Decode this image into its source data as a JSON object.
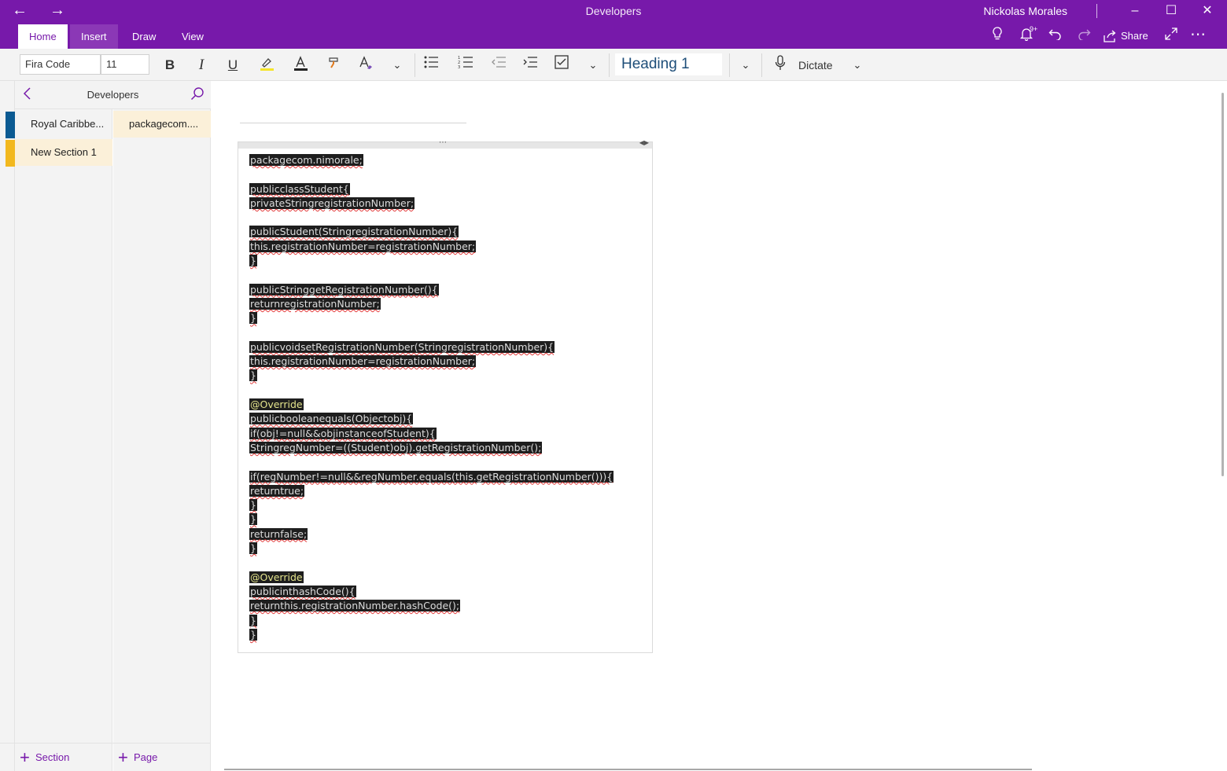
{
  "window": {
    "title": "Developers",
    "user": "Nickolas Morales"
  },
  "ribbon": {
    "tabs": [
      {
        "label": "Home",
        "active": true
      },
      {
        "label": "Insert",
        "active": false
      },
      {
        "label": "Draw",
        "active": false
      },
      {
        "label": "View",
        "active": false
      }
    ],
    "share_label": "Share",
    "notification_badge": "9+"
  },
  "toolbar": {
    "font_name": "Fira Code",
    "font_size": "11",
    "style": "Heading 1",
    "dictate_label": "Dictate",
    "highlight_color": "#f5e52a",
    "font_color": "#c00000"
  },
  "navigation": {
    "notebook_title": "Developers",
    "sections": [
      {
        "label": "Royal Caribbe...",
        "color": "#0b5a92",
        "selected": false
      },
      {
        "label": "New Section 1",
        "color": "#f2b81e",
        "selected": true
      }
    ],
    "pages": [
      {
        "label": "packagecom...."
      }
    ],
    "add_section_label": "Section",
    "add_page_label": "Page"
  },
  "code_lines": [
    "packagecom.nimorale;",
    "",
    "publicclassStudent{",
    "privateStringregistrationNumber;",
    "",
    "publicStudent(StringregistrationNumber){",
    "this.registrationNumber=registrationNumber;",
    "}",
    "",
    "publicStringgetRegistrationNumber(){",
    "returnregistrationNumber;",
    "}",
    "",
    "publicvoidsetRegistrationNumber(StringregistrationNumber){",
    "this.registrationNumber=registrationNumber;",
    "}",
    "",
    "@Override",
    "publicbooleanequals(Objectobj){",
    "if(obj!=null&&objinstanceofStudent){",
    "StringregNumber=((Student)obj).getRegistrationNumber();",
    "",
    "if(regNumber!=null&&regNumber.equals(this.getRegistrationNumber())){",
    "returntrue;",
    "}",
    "}",
    "returnfalse;",
    "}",
    "",
    "@Override",
    "publicinthashCode(){",
    "returnthis.registrationNumber.hashCode();",
    "}",
    "}"
  ],
  "accent_color": "#7719aa"
}
